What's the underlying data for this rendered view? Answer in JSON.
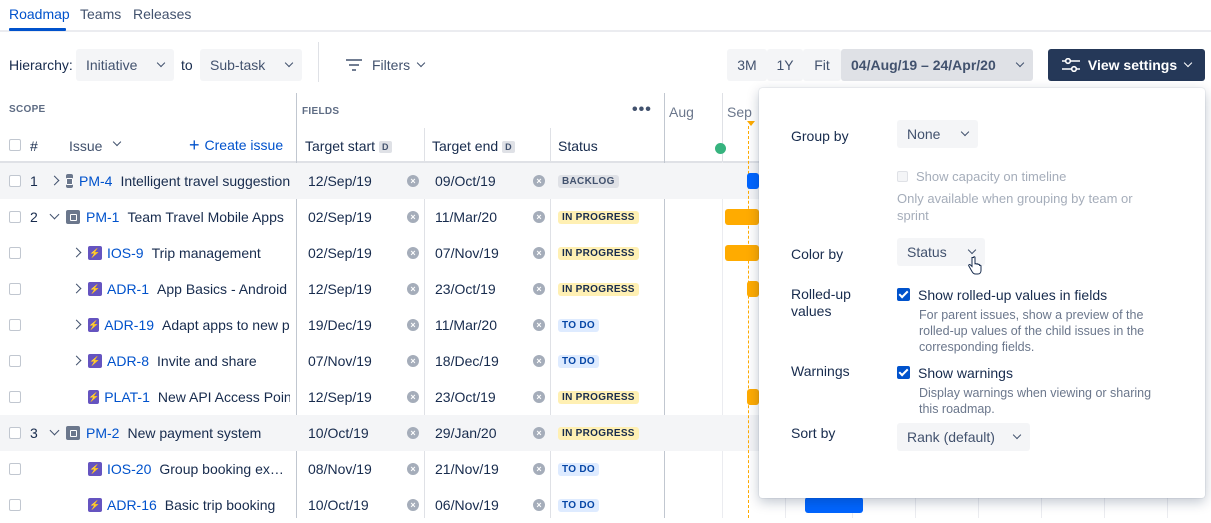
{
  "tabs": [
    {
      "label": "Roadmap"
    },
    {
      "label": "Teams"
    },
    {
      "label": "Releases"
    }
  ],
  "toolbar": {
    "hierarchy_label": "Hierarchy:",
    "hierarchy_from": "Initiative",
    "to_label": "to",
    "hierarchy_to": "Sub-task",
    "filters_label": "Filters",
    "zoom": [
      "3M",
      "1Y",
      "Fit"
    ],
    "date_range": "04/Aug/19 – 24/Apr/20",
    "view_settings_label": "View settings"
  },
  "table": {
    "scope_label": "SCOPE",
    "fields_label": "FIELDS",
    "hash_label": "#",
    "issue_label": "Issue",
    "create_issue_label": "Create issue",
    "col_target_start": "Target start",
    "col_target_end": "Target end",
    "col_status": "Status",
    "date_badge": "D",
    "months": [
      "Aug",
      "Sep"
    ],
    "rows": [
      {
        "num": "1",
        "key": "PM-4",
        "title": "Intelligent travel suggestions",
        "start": "12/Sep/19",
        "end": "09/Oct/19",
        "status": "BACKLOG"
      },
      {
        "num": "2",
        "key": "PM-1",
        "title": "Team Travel Mobile Apps",
        "start": "02/Sep/19",
        "end": "11/Mar/20",
        "status": "IN PROGRESS"
      },
      {
        "num": "",
        "key": "IOS-9",
        "title": "Trip management",
        "start": "02/Sep/19",
        "end": "07/Nov/19",
        "status": "IN PROGRESS"
      },
      {
        "num": "",
        "key": "ADR-1",
        "title": "App Basics - Android",
        "start": "12/Sep/19",
        "end": "23/Oct/19",
        "status": "IN PROGRESS"
      },
      {
        "num": "",
        "key": "ADR-19",
        "title": "Adapt apps to new payments",
        "start": "19/Dec/19",
        "end": "11/Mar/20",
        "status": "TO DO"
      },
      {
        "num": "",
        "key": "ADR-8",
        "title": "Invite and share",
        "start": "07/Nov/19",
        "end": "18/Dec/19",
        "status": "TO DO"
      },
      {
        "num": "",
        "key": "PLAT-1",
        "title": "New API Access Point",
        "start": "12/Sep/19",
        "end": "23/Oct/19",
        "status": "IN PROGRESS"
      },
      {
        "num": "3",
        "key": "PM-2",
        "title": "New payment system",
        "start": "10/Oct/19",
        "end": "29/Jan/20",
        "status": "IN PROGRESS"
      },
      {
        "num": "",
        "key": "IOS-20",
        "title": "Group booking ex…",
        "start": "08/Nov/19",
        "end": "21/Nov/19",
        "status": "TO DO"
      },
      {
        "num": "",
        "key": "ADR-16",
        "title": "Basic trip booking",
        "start": "10/Oct/19",
        "end": "06/Nov/19",
        "status": "TO DO"
      }
    ]
  },
  "settings": {
    "group_by_label": "Group by",
    "group_by_value": "None",
    "show_capacity_label": "Show capacity on timeline",
    "show_capacity_note": "Only available when grouping by team or sprint",
    "color_by_label": "Color by",
    "color_by_value": "Status",
    "rolled_up_label": "Rolled-up values",
    "rolled_up_check": "Show rolled-up values in fields",
    "rolled_up_desc": "For parent issues, show a preview of the rolled-up values of the child issues in the corresponding fields.",
    "warnings_label": "Warnings",
    "warnings_check": "Show warnings",
    "warnings_desc": "Display warnings when viewing or sharing this roadmap.",
    "sort_by_label": "Sort by",
    "sort_by_value": "Rank (default)"
  },
  "colors": {
    "accent": "#0052CC",
    "dark_button": "#253858",
    "in_progress": "#FFAB00",
    "todo_bar": "#0065FF",
    "epic": "#6554C0"
  }
}
